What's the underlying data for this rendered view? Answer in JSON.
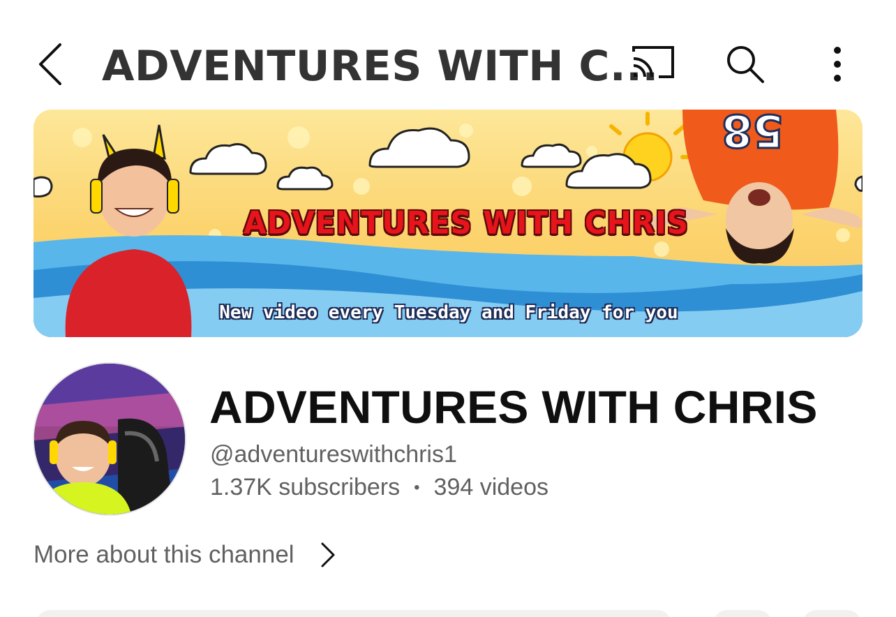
{
  "header": {
    "title": "ADVENTURES WITH C...",
    "icons": [
      "back-chevron-icon",
      "cast-icon",
      "search-icon",
      "more-vertical-icon"
    ]
  },
  "banner": {
    "title": "ADVENTURES WITH CHRIS",
    "tagline": "New video every Tuesday and Friday for you",
    "jersey_number": "58"
  },
  "channel": {
    "name": "ADVENTURES WITH CHRIS",
    "handle": "@adventureswithchris1",
    "subscribers": "1.37K subscribers",
    "separator": "•",
    "videos": "394 videos"
  },
  "about": {
    "label": "More about this channel"
  },
  "colors": {
    "primary_text": "#0f0f0f",
    "secondary_text": "#606060",
    "banner_title_red": "#e8141c"
  }
}
